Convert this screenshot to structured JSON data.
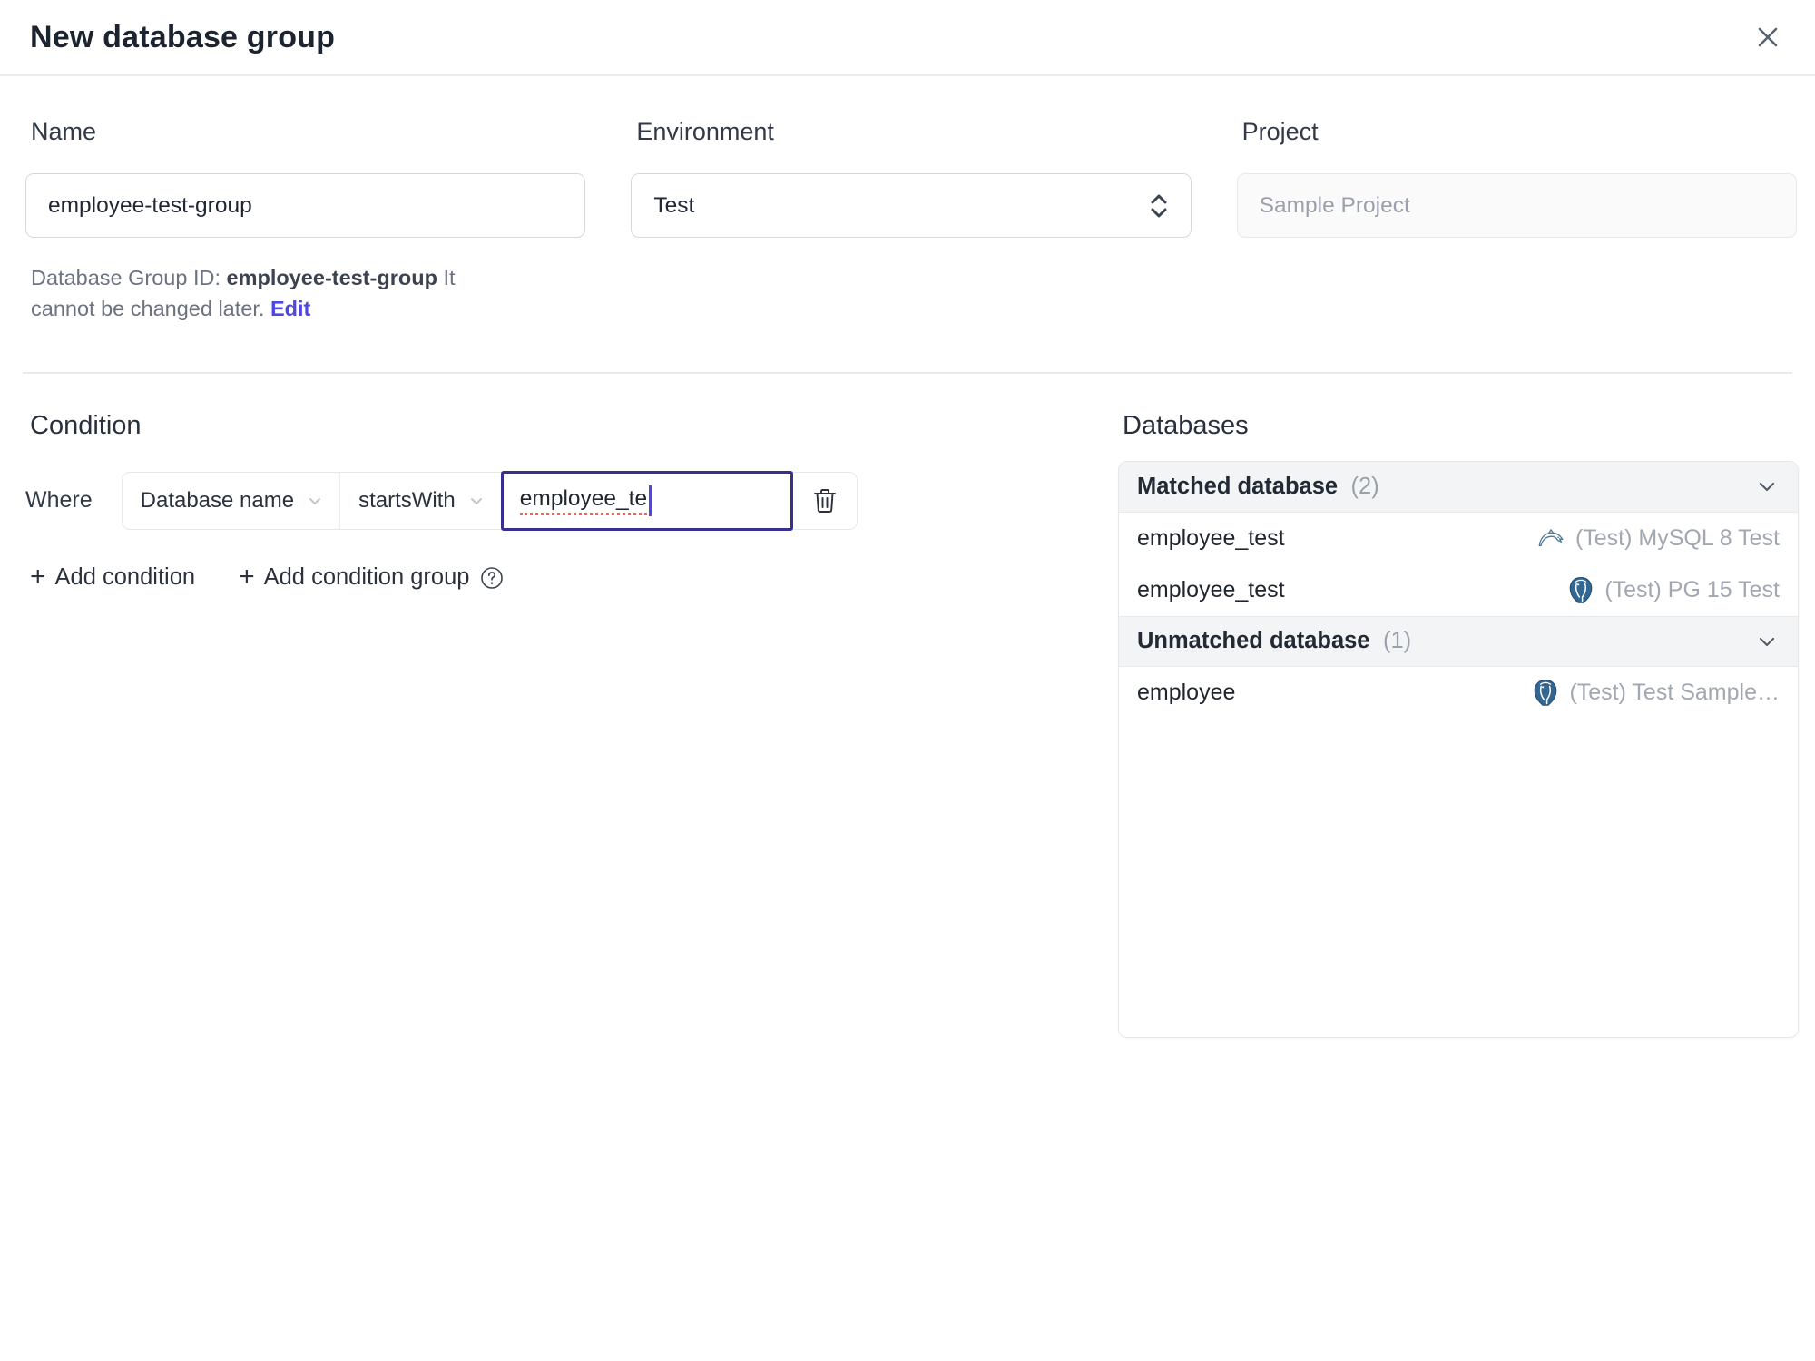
{
  "dialog": {
    "title": "New database group"
  },
  "form": {
    "name": {
      "label": "Name",
      "value": "employee-test-group"
    },
    "environment": {
      "label": "Environment",
      "value": "Test"
    },
    "project": {
      "label": "Project",
      "value": "Sample Project"
    },
    "id_helper": {
      "prefix": "Database Group ID: ",
      "id": "employee-test-group",
      "suffix": " It cannot be changed later. ",
      "edit_label": "Edit"
    }
  },
  "condition": {
    "heading": "Condition",
    "where_label": "Where",
    "factor": "Database name",
    "operator": "startsWith",
    "value": "employee_te",
    "add_condition_label": "Add condition",
    "add_condition_group_label": "Add condition group"
  },
  "databases": {
    "heading": "Databases",
    "sections": [
      {
        "title": "Matched database",
        "count": "(2)",
        "rows": [
          {
            "name": "employee_test",
            "engine": "mysql",
            "instance": "(Test) MySQL 8 Test"
          },
          {
            "name": "employee_test",
            "engine": "postgres",
            "instance": "(Test) PG 15 Test"
          }
        ]
      },
      {
        "title": "Unmatched database",
        "count": "(1)",
        "rows": [
          {
            "name": "employee",
            "engine": "postgres",
            "instance": "(Test) Test Sample…"
          }
        ]
      }
    ]
  },
  "colors": {
    "accent": "#4f46e5",
    "focus_border": "#37308f",
    "mysql_icon": "#4e7a96",
    "postgres_icon": "#336791",
    "section_header_bg": "#f3f4f6"
  }
}
